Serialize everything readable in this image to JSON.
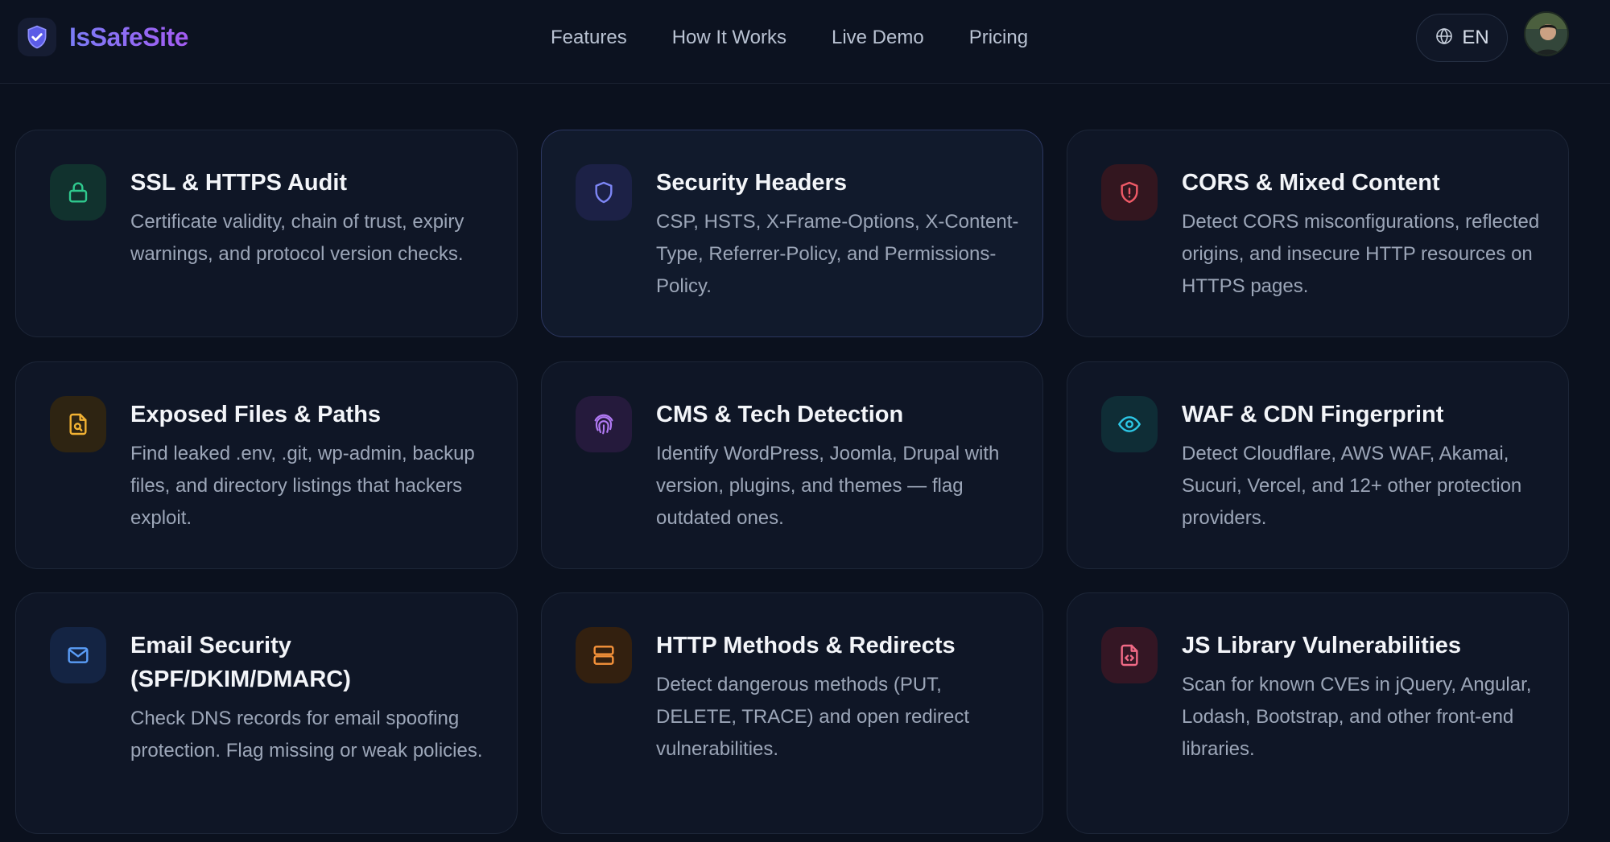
{
  "brand": {
    "name": "IsSafeSite",
    "logo_icon": "shield-check-icon"
  },
  "nav": {
    "items": [
      {
        "label": "Features"
      },
      {
        "label": "How It Works"
      },
      {
        "label": "Live Demo"
      },
      {
        "label": "Pricing"
      }
    ]
  },
  "language": {
    "label": "EN",
    "icon": "globe-icon"
  },
  "colors": {
    "background": "#0b111e",
    "card": "#0f1626",
    "brand_gradient_start": "#7b7cf6",
    "brand_gradient_end": "#a45cf2"
  },
  "features": [
    {
      "title": "SSL & HTTPS Audit",
      "description": "Certificate validity, chain of trust, expiry warnings, and protocol version checks.",
      "icon": "lock-icon",
      "accent": "#2fc98e"
    },
    {
      "title": "Security Headers",
      "description": "CSP, HSTS, X-Frame-Options, X-Content-Type, Referrer-Policy, and Permissions-Policy.",
      "icon": "shield-icon",
      "accent": "#7d86f5"
    },
    {
      "title": "CORS & Mixed Content",
      "description": "Detect CORS misconfigurations, reflected origins, and insecure HTTP resources on HTTPS pages.",
      "icon": "shield-alert-icon",
      "accent": "#ef5a67"
    },
    {
      "title": "Exposed Files & Paths",
      "description": "Find leaked .env, .git, wp-admin, backup files, and directory listings that hackers exploit.",
      "icon": "file-search-icon",
      "accent": "#f2b233"
    },
    {
      "title": "CMS & Tech Detection",
      "description": "Identify WordPress, Joomla, Drupal with version, plugins, and themes — flag outdated ones.",
      "icon": "fingerprint-icon",
      "accent": "#b27af5"
    },
    {
      "title": "WAF & CDN Fingerprint",
      "description": "Detect Cloudflare, AWS WAF, Akamai, Sucuri, Vercel, and 12+ other protection providers.",
      "icon": "eye-icon",
      "accent": "#2cc7e6"
    },
    {
      "title": "Email Security (SPF/DKIM/DMARC)",
      "description": "Check DNS records for email spoofing protection. Flag missing or weak policies.",
      "icon": "mail-icon",
      "accent": "#5a9df7"
    },
    {
      "title": "HTTP Methods & Redirects",
      "description": "Detect dangerous methods (PUT, DELETE, TRACE) and open redirect vulnerabilities.",
      "icon": "server-icon",
      "accent": "#f5923a"
    },
    {
      "title": "JS Library Vulnerabilities",
      "description": "Scan for known CVEs in jQuery, Angular, Lodash, Bootstrap, and other front-end libraries.",
      "icon": "file-code-icon",
      "accent": "#f06a86"
    }
  ]
}
